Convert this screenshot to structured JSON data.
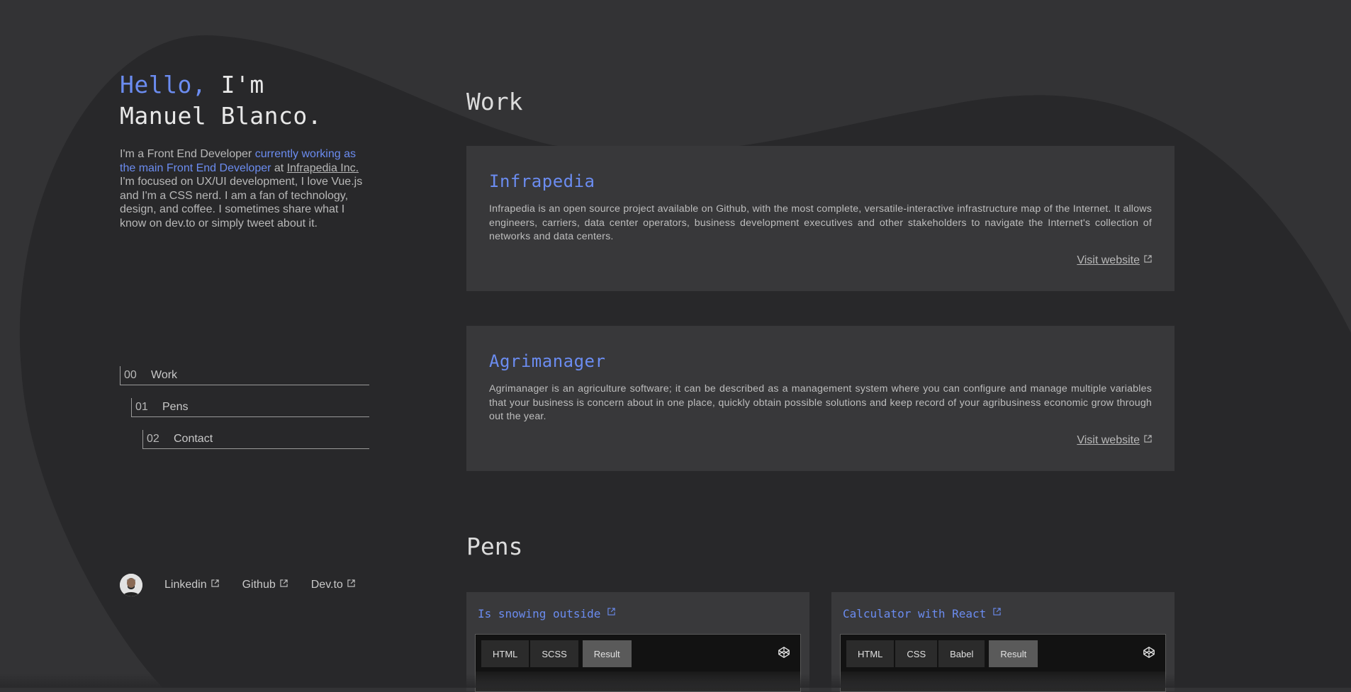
{
  "intro": {
    "hello": "Hello,",
    "im": "I'm",
    "name": "Manuel Blanco.",
    "p1": "I'm a Front End Developer ",
    "p2": "currently working as the main Front End Developer",
    "p3": " at ",
    "company": "Infrapedia Inc.",
    "p4": " I'm focused on UX/UI development, I love Vue.js and I'm a CSS nerd. I am a fan of technology, design, and coffee. I sometimes share what I know on dev.to or simply tweet about it."
  },
  "nav": [
    {
      "num": "00",
      "label": "Work"
    },
    {
      "num": "01",
      "label": "Pens"
    },
    {
      "num": "02",
      "label": "Contact"
    }
  ],
  "social": [
    {
      "label": "Linkedin"
    },
    {
      "label": "Github"
    },
    {
      "label": "Dev.to"
    }
  ],
  "work": {
    "title": "Work",
    "projects": [
      {
        "name": "Infrapedia",
        "description": "Infrapedia is an open source project available on Github, with the most complete, versatile-interactive infrastructure map of the Internet. It allows engineers, carriers, data center operators, business development executives and other stakeholders to navigate the Internet's collection of networks and data centers.",
        "link": "Visit website"
      },
      {
        "name": "Agrimanager",
        "description": "Agrimanager is an agriculture software; it can be described as a management system where you can configure and manage multiple variables that your business is concern about in one place, quickly obtain possible solutions and keep record of your agribusiness economic grow through out the year.",
        "link": "Visit website"
      }
    ]
  },
  "pens": {
    "title": "Pens",
    "items": [
      {
        "title": "Is snowing outside",
        "tabs": [
          "HTML",
          "SCSS"
        ],
        "active_tab": "Result"
      },
      {
        "title": "Calculator with React",
        "tabs": [
          "HTML",
          "CSS",
          "Babel"
        ],
        "active_tab": "Result"
      }
    ]
  },
  "colors": {
    "background": "#333335",
    "blob": "#28282a",
    "card": "#38383a",
    "accent": "#6b8cf0",
    "text": "#c9c9c9"
  }
}
